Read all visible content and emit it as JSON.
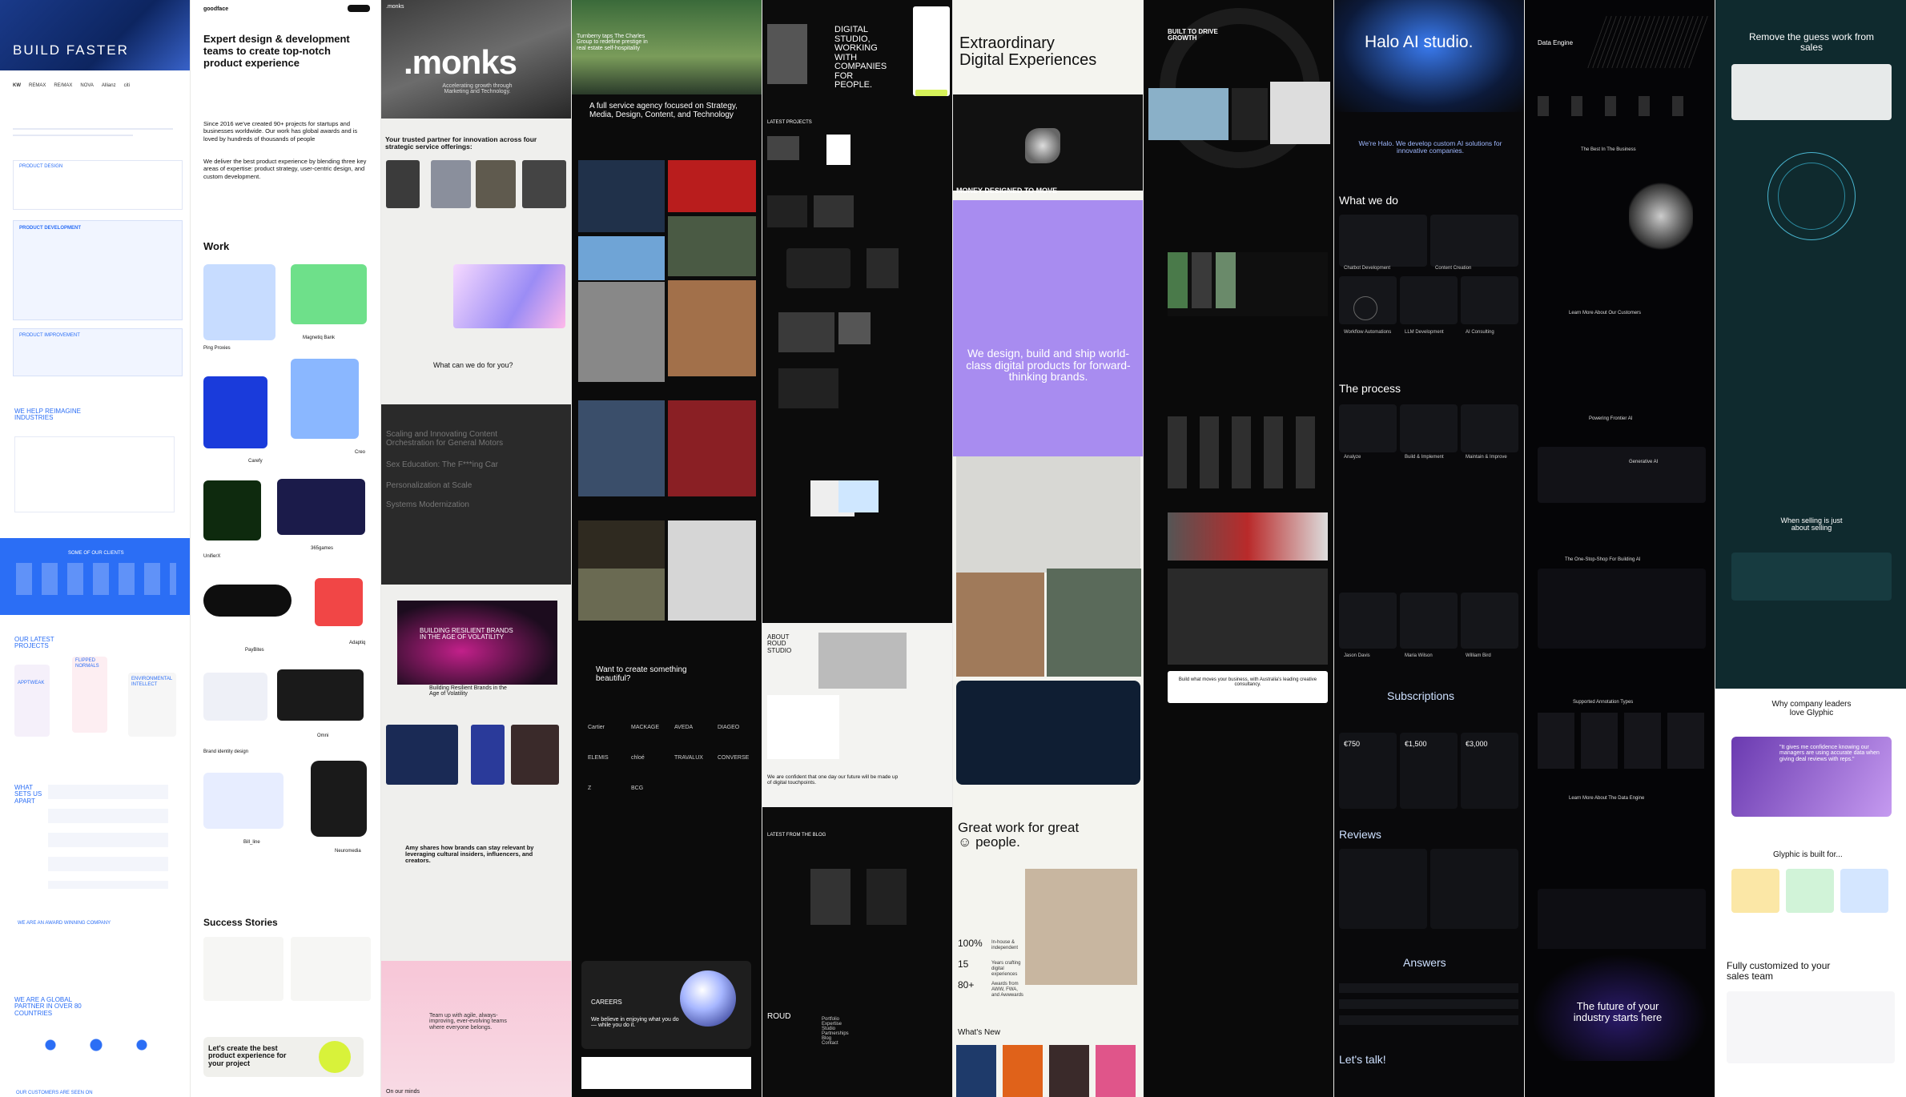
{
  "strips": [
    {
      "id": "ui-tech",
      "hero_title": "BUILD FASTER",
      "logos": [
        "KW",
        "REMAX",
        "RE/MAX",
        "NOVA",
        "Ripple",
        "Allianz",
        "citi"
      ],
      "section1": "PRODUCT DESIGN",
      "section2": "PRODUCT DEVELOPMENT",
      "section3": "PRODUCT IMPROVEMENT",
      "industries": "WE HELP REIMAGINE INDUSTRIES",
      "clients": "SOME OF OUR CLIENTS",
      "latest": "OUR LATEST PROJECTS",
      "projects": [
        "APPTWEAK",
        "FLIPPED NORMALS",
        "ENVIRONMENTAL INTELLECT"
      ],
      "apart": "WHAT SETS US APART",
      "award": "WE ARE AN AWARD WINNING COMPANY",
      "partner": "WE ARE A GLOBAL PARTNER IN OVER 80 COUNTRIES",
      "footer_note": "OUR CUSTOMERS ARE SEEN ON"
    },
    {
      "id": "goodface",
      "logo": "goodface",
      "hero": "Expert design & development teams to create top-notch product experience",
      "since": "Since 2016 we've created 90+ projects for startups and businesses worldwide. Our work has global awards and is loved by hundreds of thousands of people",
      "deliver": "We deliver the best product experience by blending three key areas of expertise: product strategy, user-centric design, and custom development.",
      "work": "Work",
      "work_items": [
        "Ping Proxies",
        "Magnetiq Bank",
        "Carefy",
        "Creo",
        "UnifierX",
        "365games",
        "PayBites",
        "Adaptiq",
        "Omni",
        "Brand identity design",
        "Bill_line",
        "Neuromedia"
      ],
      "success": "Success Stories",
      "cta": "Let's create the best product experience for your project"
    },
    {
      "id": "monks",
      "logo": ".monks",
      "hero": ".monks",
      "tagline": "Accelerating growth through Marketing and Technology.",
      "partner": "Your trusted partner for innovation across four strategic service offerings:",
      "what": "What can we do for you?",
      "topics": [
        "Scaling and Innovating Content Orchestration for General Motors",
        "Sex Education: The F***ing Car",
        "Personalization at Scale",
        "Systems Modernization"
      ],
      "resilient_title": "BUILDING RESILIENT BRANDS IN THE AGE OF VOLATILITY",
      "resilient": "Building Resilient Brands in the Age of Volatility",
      "shares": "Amy shares how brands can stay relevant by leveraging cultural insiders, influencers, and creators.",
      "team": "Team up with agile, always-improving, ever-evolving teams where everyone belongs.",
      "mind": "On our minds"
    },
    {
      "id": "charles",
      "hero_caption": "Turnberry taps The Charles Group to redefine prestige in real estate self-hospitality",
      "agency": "A full service agency focused on Strategy, Media, Design, Content, and Technology",
      "create": "Want to create something beautiful?",
      "clients": [
        "Cartier",
        "MACKAGE",
        "AVEDA",
        "DIAGEO",
        "ELEMIS",
        "chloé",
        "TRAVALUX",
        "CONVERSE",
        "Z",
        "BCG"
      ],
      "careers": "CAREERS",
      "careers_text": "We believe in enjoying what you do — while you do it."
    },
    {
      "id": "roud",
      "hero": "DIGITAL STUDIO, WORKING WITH COMPANIES FOR PEOPLE.",
      "latest": "LATEST PROJECTS",
      "about": "ABOUT ROUD STUDIO",
      "confident": "We are confident that one day our future will be made up of digital touchpoints.",
      "blog": "LATEST FROM THE BLOG",
      "logo": "ROUD",
      "footer_nav": [
        "Portfolio",
        "Expertise",
        "Studio",
        "Partnerships",
        "Blog",
        "Contact"
      ]
    },
    {
      "id": "momentum",
      "hero": "Extraordinary Digital Experiences",
      "banner": "MONEY DESIGNED TO MOVE",
      "purple": "We design, build and ship world-class digital products for forward-thinking brands.",
      "great": "Great work for great ☺ people.",
      "stats": [
        {
          "v": "100%",
          "l": "In-house & independent"
        },
        {
          "v": "15",
          "l": "Years crafting digital experiences"
        },
        {
          "v": "80+",
          "l": "Awards from AWW, FWA, and Awwwards"
        }
      ],
      "new": "What's New"
    },
    {
      "id": "byagency",
      "hero": "BUILT TO DRIVE GROWTH",
      "cta": "Build what moves your business, with Australia's leading creative consultancy."
    },
    {
      "id": "halo",
      "hero": "Halo AI studio.",
      "intro": "We're Halo. We develop custom AI solutions for innovative companies.",
      "what": "What we do",
      "services": [
        "Chatbot Development",
        "Content Creation",
        "Workflow Automations",
        "LLM Development",
        "AI Consulting"
      ],
      "process": "The process",
      "steps": [
        "Analyze",
        "Build & Implement",
        "Maintain & Improve"
      ],
      "team": [
        "Jason Davis",
        "Maria Wilson",
        "William Bird"
      ],
      "subs": "Subscriptions",
      "prices": [
        "€750",
        "€1,500",
        "€3,000"
      ],
      "reviews": "Reviews",
      "answers": "Answers",
      "talk": "Let's talk!"
    },
    {
      "id": "dataengine",
      "hero": "Data Engine",
      "best": "The Best In The Business",
      "learn": "Learn More About Our Customers",
      "frontier": "Powering Frontier AI",
      "gen": "Generative AI",
      "stop": "The One-Stop-Shop For Building AI",
      "supported": "Supported Annotation Types",
      "learn2": "Learn More About The Data Engine",
      "future": "The future of your industry starts here"
    },
    {
      "id": "glyphic",
      "hero": "Remove the guess work from sales",
      "selling": "When selling is just about selling",
      "why": "Why company leaders love Glyphic",
      "quote": "\"It gives me confidence knowing our managers are using accurate data when giving deal reviews with reps.\"",
      "built": "Glyphic is built for...",
      "custom": "Fully customized to your sales team"
    }
  ],
  "colors": {
    "blue": "#2b6ef5",
    "purple": "#a88cf0",
    "lime": "#c6f25a",
    "dark": "#0b0b0c",
    "halo_blue": "#3a7bf0"
  }
}
